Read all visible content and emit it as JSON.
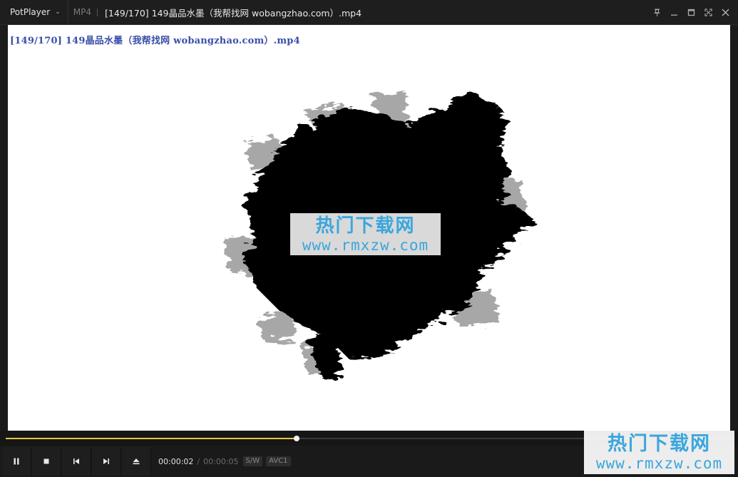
{
  "titlebar": {
    "app_name": "PotPlayer",
    "format": "MP4",
    "file_title": "[149/170] 149晶品水墨（我帮找网 wobangzhao.com）.mp4",
    "controls": [
      "pin-icon",
      "minimize-icon",
      "maximize-icon",
      "fullscreen-icon",
      "close-icon"
    ]
  },
  "video": {
    "osd_title": "[149/170] 149晶品水墨（我帮找网 wobangzhao.com）.mp4",
    "watermark_cn": "热门下载网",
    "watermark_url": "www.rmxzw.com"
  },
  "playback": {
    "progress": 0.4,
    "current_time": "00:00:02",
    "separator": "/",
    "total_time": "00:00:05",
    "render_tag": "S/W",
    "codec_tag": "AVC1",
    "buttons": [
      "pause-icon",
      "stop-icon",
      "previous-icon",
      "next-icon",
      "eject-icon"
    ]
  },
  "corner_watermark": {
    "cn": "热门下载网",
    "url": "www.rmxzw.com"
  },
  "colors": {
    "progress_fill": "#e8c440",
    "osd_text": "#3a4fa8",
    "watermark": "#3aa6dd"
  }
}
